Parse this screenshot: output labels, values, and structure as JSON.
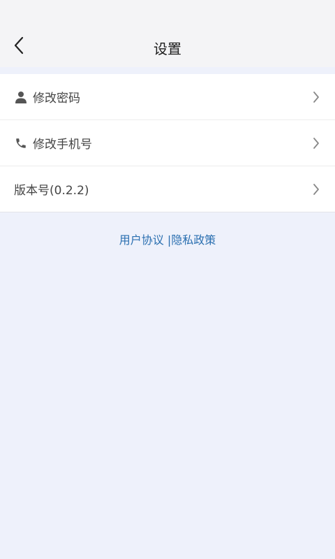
{
  "header": {
    "title": "设置",
    "back_icon": "chevron-left-icon"
  },
  "settings": {
    "items": [
      {
        "label": "修改密码",
        "icon": "user-icon"
      },
      {
        "label": "修改手机号",
        "icon": "phone-icon"
      },
      {
        "label": "版本号(0.2.2)",
        "icon": ""
      }
    ]
  },
  "footer_links": {
    "user_agreement": "用户协议",
    "separator": " |",
    "privacy_policy": "隐私政策"
  },
  "colors": {
    "background": "#eef1fb",
    "link": "#2a6fb0",
    "text": "#444444"
  }
}
